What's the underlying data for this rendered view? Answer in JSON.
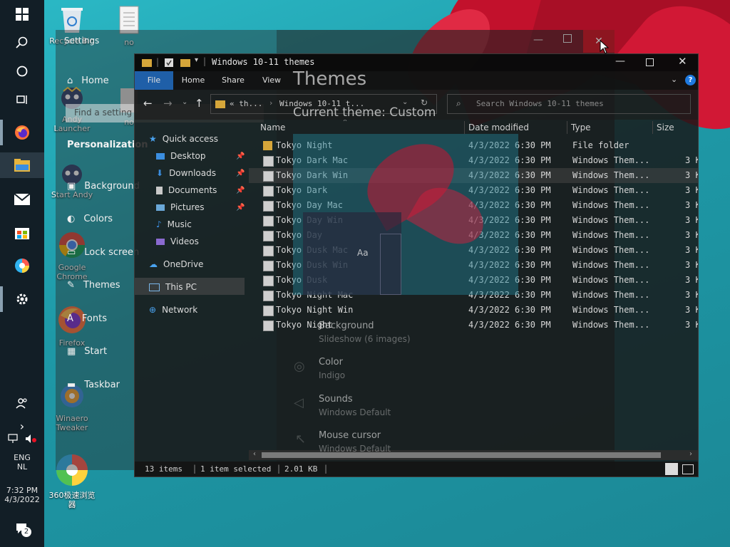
{
  "taskbar": {
    "clock": {
      "time": "7:32 PM",
      "date": "4/3/2022"
    },
    "language": {
      "line1": "ENG",
      "line2": "NL"
    },
    "notification_badge": "2"
  },
  "desktop_icons": [
    {
      "label": "Recycle Bin"
    },
    {
      "label": "no"
    },
    {
      "label": "Andy Launcher"
    },
    {
      "label": "no"
    },
    {
      "label": "Start Andy"
    },
    {
      "label": "Google Chrome"
    },
    {
      "label": "Firefox"
    },
    {
      "label": "Winaero Tweaker"
    },
    {
      "label": "360极速浏览器"
    }
  ],
  "settings": {
    "title": "Settings",
    "search_placeholder": "Find a setting",
    "home": "Home",
    "section": "Personalization",
    "nav": [
      {
        "label": "Background"
      },
      {
        "label": "Colors"
      },
      {
        "label": "Lock screen"
      },
      {
        "label": "Themes"
      },
      {
        "label": "Fonts"
      },
      {
        "label": "Start"
      },
      {
        "label": "Taskbar"
      }
    ],
    "page_title": "Themes",
    "current_theme": "Current theme: Custom",
    "preview_sample": "Aa",
    "options": [
      {
        "title": "Background",
        "value": "Slideshow (6 images)"
      },
      {
        "title": "Color",
        "value": "Indigo"
      },
      {
        "title": "Sounds",
        "value": "Windows Default"
      },
      {
        "title": "Mouse cursor",
        "value": "Windows Default"
      }
    ]
  },
  "explorer": {
    "title": "Windows 10-11 themes",
    "ribbon_tabs": [
      "File",
      "Home",
      "Share",
      "View"
    ],
    "address": {
      "part1": "« th...",
      "part2": "Windows 10-11 t..."
    },
    "search_placeholder": "Search Windows 10-11 themes",
    "nav": [
      {
        "label": "Quick access"
      },
      {
        "label": "Desktop"
      },
      {
        "label": "Downloads"
      },
      {
        "label": "Documents"
      },
      {
        "label": "Pictures"
      },
      {
        "label": "Music"
      },
      {
        "label": "Videos"
      },
      {
        "label": "OneDrive"
      },
      {
        "label": "This PC"
      },
      {
        "label": "Network"
      }
    ],
    "columns": {
      "name": "Name",
      "date": "Date modified",
      "type": "Type",
      "size": "Size"
    },
    "files": [
      {
        "name": "Tokyo Night",
        "date": "4/3/2022 6:30 PM",
        "type": "File folder",
        "size": ""
      },
      {
        "name": "Tokyo Dark Mac",
        "date": "4/3/2022 6:30 PM",
        "type": "Windows Them...",
        "size": "3 K"
      },
      {
        "name": "Tokyo Dark Win",
        "date": "4/3/2022 6:30 PM",
        "type": "Windows Them...",
        "size": "3 K"
      },
      {
        "name": "Tokyo Dark",
        "date": "4/3/2022 6:30 PM",
        "type": "Windows Them...",
        "size": "3 K"
      },
      {
        "name": "Tokyo Day Mac",
        "date": "4/3/2022 6:30 PM",
        "type": "Windows Them...",
        "size": "3 K"
      },
      {
        "name": "Tokyo Day Win",
        "date": "4/3/2022 6:30 PM",
        "type": "Windows Them...",
        "size": "3 K"
      },
      {
        "name": "Tokyo Day",
        "date": "4/3/2022 6:30 PM",
        "type": "Windows Them...",
        "size": "3 K"
      },
      {
        "name": "Tokyo Dusk Mac",
        "date": "4/3/2022 6:30 PM",
        "type": "Windows Them...",
        "size": "3 K"
      },
      {
        "name": "Tokyo Dusk Win",
        "date": "4/3/2022 6:30 PM",
        "type": "Windows Them...",
        "size": "3 K"
      },
      {
        "name": "Tokyo Dusk",
        "date": "4/3/2022 6:30 PM",
        "type": "Windows Them...",
        "size": "3 K"
      },
      {
        "name": "Tokyo Night Mac",
        "date": "4/3/2022 6:30 PM",
        "type": "Windows Them...",
        "size": "3 K"
      },
      {
        "name": "Tokyo Night Win",
        "date": "4/3/2022 6:30 PM",
        "type": "Windows Them...",
        "size": "3 K"
      },
      {
        "name": "Tokyo Night",
        "date": "4/3/2022 6:30 PM",
        "type": "Windows Them...",
        "size": "3 K"
      }
    ],
    "status": {
      "items": "13 items",
      "selected": "1 item selected",
      "size": "2.01 KB"
    }
  }
}
